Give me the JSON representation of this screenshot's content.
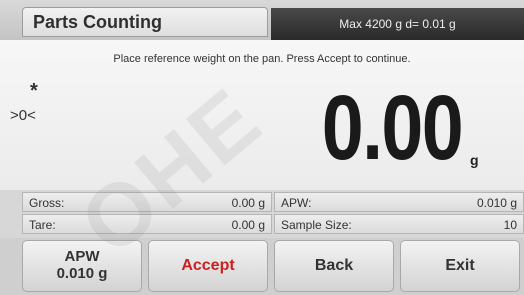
{
  "header": {
    "title": "Parts Counting",
    "capacity_info": "Max 4200 g  d= 0.01 g"
  },
  "main": {
    "instruction": "Place reference weight on the pan.  Press Accept to continue.",
    "stability_indicator": "*",
    "center_of_zero_indicator": ">0<",
    "weight_value": "0.00",
    "weight_unit": "g"
  },
  "info": {
    "gross_label": "Gross:",
    "gross_value": "0.00 g",
    "tare_label": "Tare:",
    "tare_value": "0.00 g",
    "apw_label": "APW:",
    "apw_value": "0.010 g",
    "sample_size_label": "Sample Size:",
    "sample_size_value": "10"
  },
  "buttons": {
    "apw_line1": "APW",
    "apw_line2": "0.010 g",
    "accept": "Accept",
    "back": "Back",
    "exit": "Exit"
  },
  "watermark": "OHE",
  "colors": {
    "accept_text": "#cc1f1f",
    "capacity_bar": "#2f2f2f"
  }
}
